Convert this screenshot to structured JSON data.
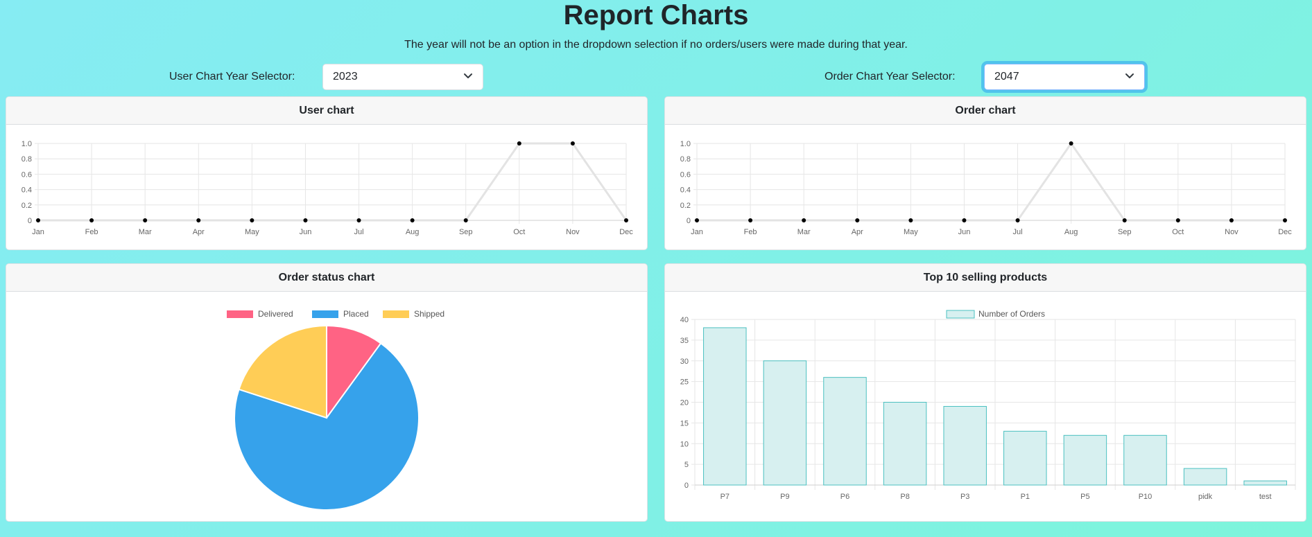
{
  "page": {
    "title": "Report Charts",
    "subtitle": "The year will not be an option in the dropdown selection if no orders/users were made during that year."
  },
  "selectors": {
    "user": {
      "label": "User Chart Year Selector:",
      "value": "2023"
    },
    "order": {
      "label": "Order Chart Year Selector:",
      "value": "2047"
    }
  },
  "cards": {
    "user_chart": "User chart",
    "order_chart": "Order chart",
    "status_chart": "Order status chart",
    "top_products": "Top 10 selling products"
  },
  "colors": {
    "line": "#e3e3e3",
    "point": "#000000",
    "delivered": "#ff6384",
    "placed": "#36a2eb",
    "shipped": "#ffcd56",
    "bar_fill": "#d7f0f0",
    "bar_border": "#4bc0c0"
  },
  "chart_data": [
    {
      "id": "user",
      "type": "line",
      "x": [
        "Jan",
        "Feb",
        "Mar",
        "Apr",
        "May",
        "Jun",
        "Jul",
        "Aug",
        "Sep",
        "Oct",
        "Nov",
        "Dec"
      ],
      "values": [
        0,
        0,
        0,
        0,
        0,
        0,
        0,
        0,
        0,
        1,
        1,
        0
      ],
      "ylim": [
        0,
        1
      ],
      "yticks": [
        "0",
        "0.2",
        "0.4",
        "0.6",
        "0.8",
        "1.0"
      ],
      "grid": true
    },
    {
      "id": "order",
      "type": "line",
      "x": [
        "Jan",
        "Feb",
        "Mar",
        "Apr",
        "May",
        "Jun",
        "Jul",
        "Aug",
        "Sep",
        "Oct",
        "Nov",
        "Dec"
      ],
      "values": [
        0,
        0,
        0,
        0,
        0,
        0,
        0,
        1,
        0,
        0,
        0,
        0
      ],
      "ylim": [
        0,
        1
      ],
      "yticks": [
        "0",
        "0.2",
        "0.4",
        "0.6",
        "0.8",
        "1.0"
      ],
      "grid": true
    },
    {
      "id": "status",
      "type": "pie",
      "labels": [
        "Delivered",
        "Placed",
        "Shipped"
      ],
      "values": [
        10,
        70,
        20
      ],
      "legend": "top"
    },
    {
      "id": "top10",
      "type": "bar",
      "categories": [
        "P7",
        "P9",
        "P6",
        "P8",
        "P3",
        "P1",
        "P5",
        "P10",
        "pidk",
        "test"
      ],
      "series": [
        {
          "name": "Number of Orders",
          "values": [
            38,
            30,
            26,
            20,
            19,
            13,
            12,
            12,
            4,
            1
          ]
        }
      ],
      "ylim": [
        0,
        40
      ],
      "yticks": [
        "0",
        "5",
        "10",
        "15",
        "20",
        "25",
        "30",
        "35",
        "40"
      ],
      "legend": "top",
      "grid": true
    }
  ]
}
